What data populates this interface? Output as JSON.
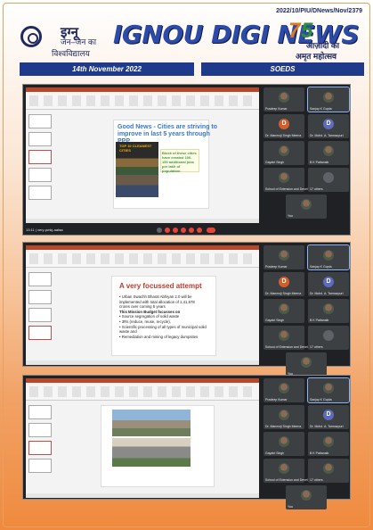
{
  "header": {
    "ref": "2022/10/PIU/DNews/Nov/2379",
    "hindi_big": "इग्नू",
    "hindi_mid": "जन–जन का",
    "hindi_small": "विश्वविद्यालय",
    "title": "IGNOU DIGI NEWS",
    "azadi_num_a": "7",
    "azadi_num_b": "5",
    "azadi_line1": "आज़ादी का",
    "azadi_line2": "अमृत महोत्सव"
  },
  "band": {
    "date": "14th November 2022",
    "unit": "SOEDS"
  },
  "shot1": {
    "slide_title": "Good News - Cities are striving to improve in last 5 years through PPP",
    "top10": "TOP 10 CLEANEST CITIES",
    "box_text": "Block of these cities have created 100-150 additional jobs per lakh of population",
    "tiles": [
      {
        "name": "Pradeep Kumar",
        "kind": "face"
      },
      {
        "name": "Sanjay K Gupta",
        "kind": "face"
      },
      {
        "name": "Dr. Manmoji Singh Meena",
        "kind": "letter",
        "letter": "D",
        "color": "#d45d2a"
      },
      {
        "name": "Dr. Mohd. A. Tarmazpuri",
        "kind": "letter",
        "letter": "D",
        "color": "#5c6bc0"
      },
      {
        "name": "Gayatri Singh",
        "kind": "face"
      },
      {
        "name": "B K Pattanaik",
        "kind": "face"
      },
      {
        "name": "School of Extension and Devel...",
        "kind": "face"
      },
      {
        "name": "17 others",
        "kind": "letter",
        "letter": "",
        "color": "#5f6368"
      },
      {
        "name": "You",
        "kind": "face"
      }
    ],
    "meet_time": "13:11 | very-pmkj-aafaa"
  },
  "shot2": {
    "slide_title": "A very focussed attempt",
    "bullets": [
      "• Urban Swachh Bharat Abhiyan 2.0 will be",
      "   implemented with total allocation of 1,41,678",
      "   crores over coming 5 years",
      "This Mission Budget focusses on",
      "• Source segregation of solid waste",
      "• 3Rs (reduce, reuse, recycle),",
      "• Scientific processing of all types of municipal solid",
      "   waste and",
      "• Remediation and mining of legacy dumpsites"
    ],
    "tiles": [
      {
        "name": "Pradeep Kumar",
        "kind": "face"
      },
      {
        "name": "Sanjay K Gupta",
        "kind": "face"
      },
      {
        "name": "Dr. Manmoji Singh Meena",
        "kind": "letter",
        "letter": "D",
        "color": "#d45d2a"
      },
      {
        "name": "Dr. Mohd. A. Tarmazpuri",
        "kind": "letter",
        "letter": "D",
        "color": "#5c6bc0"
      },
      {
        "name": "Gayatri Singh",
        "kind": "face"
      },
      {
        "name": "B K Pattanaik",
        "kind": "face"
      },
      {
        "name": "School of Extension and Devel...",
        "kind": "face"
      },
      {
        "name": "17 others",
        "kind": "letter",
        "letter": "",
        "color": "#5f6368"
      },
      {
        "name": "You",
        "kind": "face"
      }
    ]
  },
  "shot3": {
    "tiles": [
      {
        "name": "Pradeep Kumar",
        "kind": "face"
      },
      {
        "name": "Sanjay K Gupta",
        "kind": "face"
      },
      {
        "name": "Dr. Manmoji Singh Meena",
        "kind": "face"
      },
      {
        "name": "Dr. Mohd. A. Tarmazpuri",
        "kind": "letter",
        "letter": "D",
        "color": "#5c6bc0"
      },
      {
        "name": "Gayatri Singh",
        "kind": "face"
      },
      {
        "name": "B K Pattanaik",
        "kind": "face"
      },
      {
        "name": "School of Extension and Devel...",
        "kind": "face"
      },
      {
        "name": "17 others",
        "kind": "face"
      },
      {
        "name": "You",
        "kind": "face"
      }
    ]
  },
  "colors": {
    "navy": "#1f3a8a",
    "title_blue": "#2c4aa8",
    "orange": "#ef8a3e",
    "ppt_red": "#b7472a"
  }
}
